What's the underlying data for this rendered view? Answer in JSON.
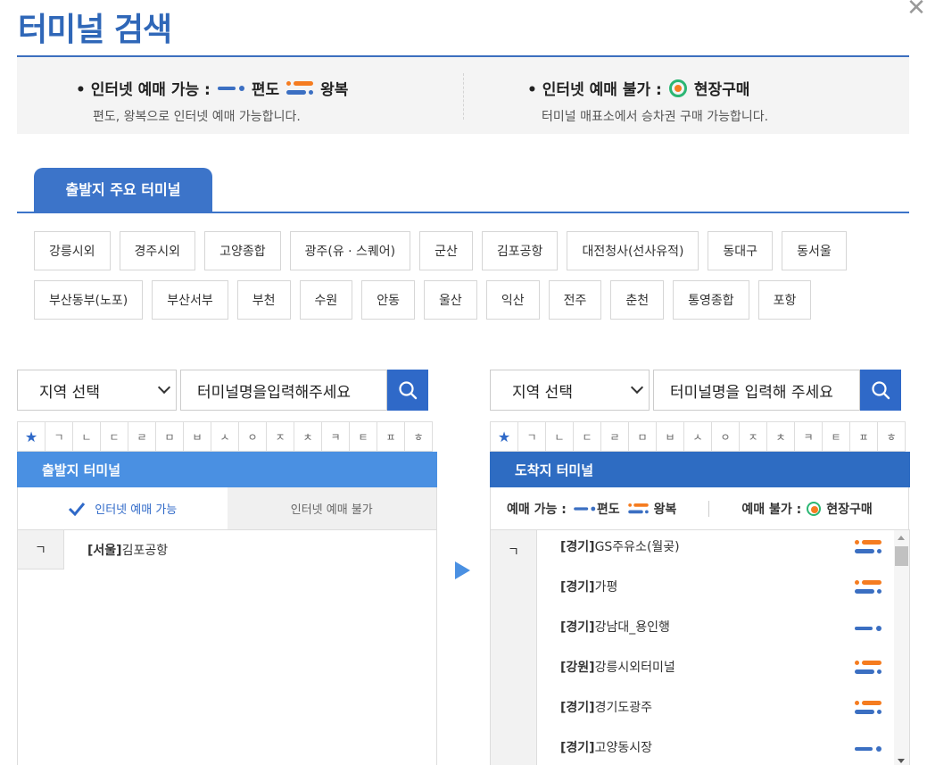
{
  "title": "터미널 검색",
  "close_label": "✕",
  "info": {
    "online_title": "• 인터넷 예매 가능 :",
    "oneway_label": "편도",
    "round_label": "왕복",
    "online_desc": "편도, 왕복으로 인터넷 예매 가능합니다.",
    "offline_title": "• 인터넷 예매 불가 :",
    "site_label": "현장구매",
    "offline_desc": "터미널 매표소에서 승차권 구매 가능합니다."
  },
  "main_tab": "출발지 주요 터미널",
  "major_terminals": {
    "row1": [
      "강릉시외",
      "경주시외",
      "고양종합",
      "광주(유 · 스퀘어)",
      "군산",
      "김포공항",
      "대전청사(선사유적)",
      "동대구",
      "동서울"
    ],
    "row2": [
      "부산동부(노포)",
      "부산서부",
      "부천",
      "수원",
      "안동",
      "울산",
      "익산",
      "전주",
      "춘천",
      "통영종합",
      "포항"
    ]
  },
  "consonants": [
    "★",
    "ㄱ",
    "ㄴ",
    "ㄷ",
    "ㄹ",
    "ㅁ",
    "ㅂ",
    "ㅅ",
    "ㅇ",
    "ㅈ",
    "ㅊ",
    "ㅋ",
    "ㅌ",
    "ㅍ",
    "ㅎ"
  ],
  "departure": {
    "region_select": "지역 선택",
    "search_value": "터미널명을입력해주세요",
    "list_title": "출발지 터미널",
    "tab_online": "인터넷 예매 가능",
    "tab_offline": "인터넷 예매 불가",
    "letter": "ㄱ",
    "items": [
      {
        "region": "[서울]",
        "name": "김포공항"
      }
    ]
  },
  "arrival": {
    "region_select": "지역 선택",
    "search_value": "터미널명을 입력해 주세요",
    "list_title": "도착지 터미널",
    "legend_online": "예매 가능 :",
    "legend_oneway": "편도",
    "legend_round": "왕복",
    "legend_offline": "예매 불가 :",
    "legend_site": "현장구매",
    "letter": "ㄱ",
    "items": [
      {
        "region": "[경기]",
        "name": "GS주유소(월곶)",
        "icon": "round-trip-icon"
      },
      {
        "region": "[경기]",
        "name": "가평",
        "icon": "round-trip-icon"
      },
      {
        "region": "[경기]",
        "name": "강남대_용인행",
        "icon": "one-way-icon"
      },
      {
        "region": "[강원]",
        "name": "강릉시외터미널",
        "icon": "round-trip-icon"
      },
      {
        "region": "[경기]",
        "name": "경기도광주",
        "icon": "round-trip-icon"
      },
      {
        "region": "[경기]",
        "name": "고양동시장",
        "icon": "one-way-icon"
      }
    ]
  },
  "colors": {
    "primary": "#2f67b8",
    "oneway": "#3b6fc2",
    "round": "#f57c20",
    "site": "#2bb673"
  }
}
